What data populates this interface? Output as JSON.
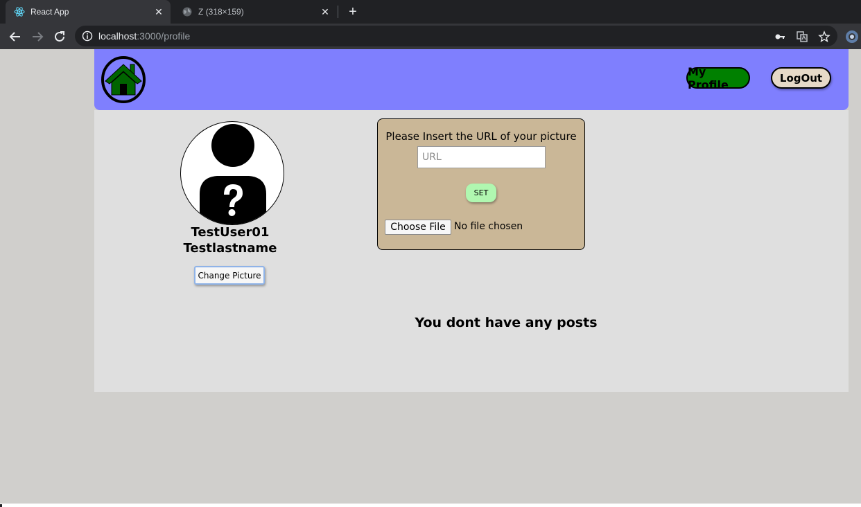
{
  "browser": {
    "tabs": [
      {
        "title": "React App",
        "icon": "react-logo-icon",
        "active": true
      },
      {
        "title": "Z (318×159)",
        "icon": "globe-icon",
        "active": false
      }
    ],
    "address": {
      "host": "localhost",
      "path": ":3000/profile"
    },
    "colors": {
      "tabbar": "#202124",
      "toolbar": "#35363a"
    }
  },
  "header": {
    "logo_icon": "home-icon",
    "my_profile_label": "My Profile",
    "logout_label": "LogOut",
    "colors": {
      "background": "#7f7ffe",
      "my_profile": "#008000",
      "logout": "#e6d9c8",
      "logo": "#006400"
    }
  },
  "profile": {
    "avatar_icon": "unknown-user-avatar",
    "first_name": "TestUser01",
    "last_name": "Testlastname",
    "change_picture_label": "Change Picture"
  },
  "picture_form": {
    "title": "Please Insert the URL of your picture",
    "url_placeholder": "URL",
    "url_value": "",
    "set_label": "SET",
    "choose_file_label": "Choose File",
    "file_status": "No file chosen",
    "colors": {
      "panel": "#cab797",
      "set_button": "#b0f7b0"
    }
  },
  "posts": {
    "empty_message": "You dont have any posts"
  },
  "page_colors": {
    "background": "#d0cfcc",
    "content": "#dfdfdf"
  }
}
